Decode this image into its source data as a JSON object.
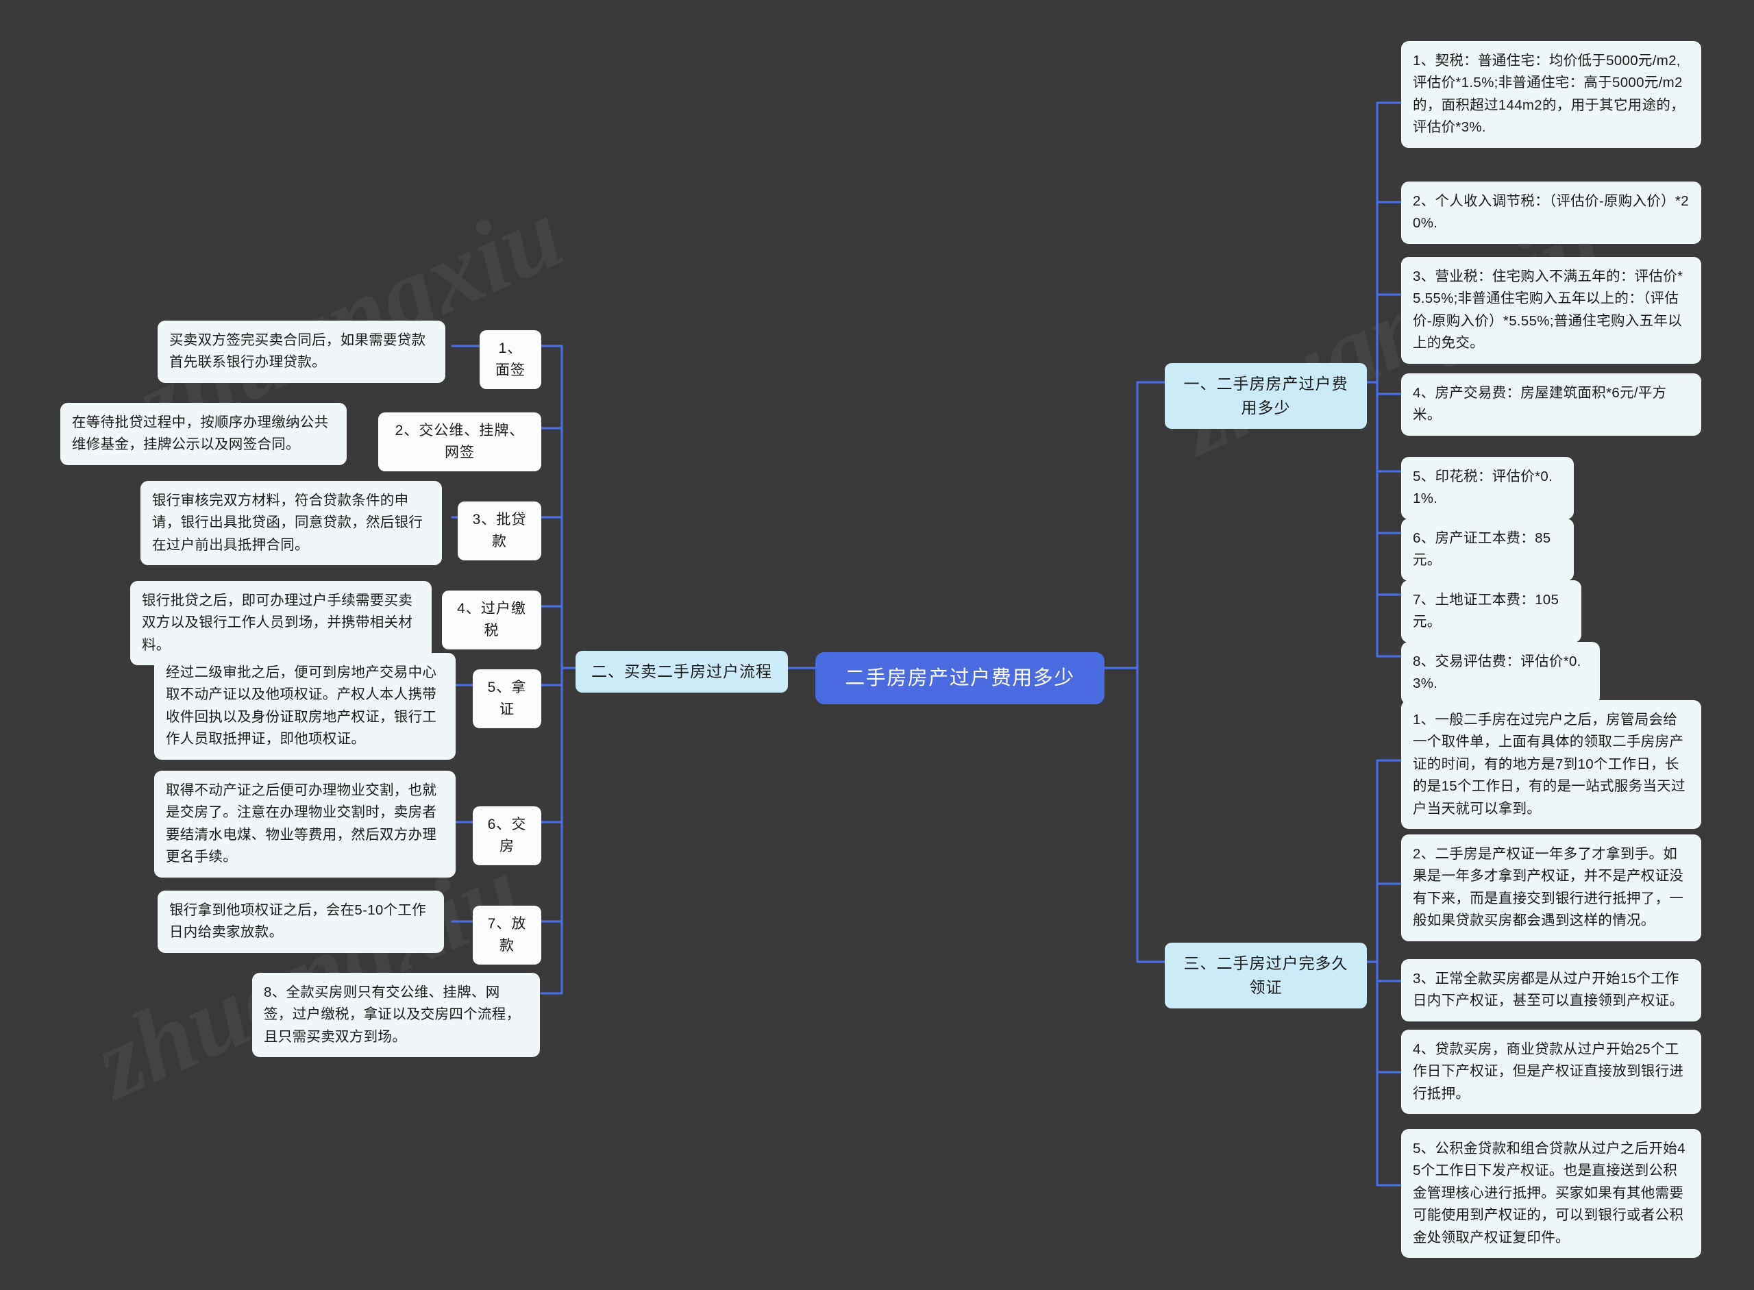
{
  "theme": {
    "background": "#3a3a3a",
    "root_fill": "#4a6ce0",
    "root_text": "#ffffff",
    "branch_fill": "#cdeaf7",
    "leaf_fill": "#eff6f8",
    "step_fill": "#fbfcfd",
    "edge_color": "#4a6ce0",
    "node_text": "#1b1b1b"
  },
  "watermarks": [
    {
      "text": "zhuangxiu"
    },
    {
      "text": "zhuangxiu"
    },
    {
      "text": "zhuangxiu"
    }
  ],
  "mindmap": {
    "root": {
      "label": "二手房房产过户费用多少"
    },
    "branches": [
      {
        "id": "branch-fees",
        "label": "一、二手房房产过户费用多少",
        "children": [
          {
            "label": "1、契税：普通住宅：均价低于5000元/m2,评估价*1.5%;非普通住宅：高于5000元/m2的，面积超过144m2的，用于其它用途的，评估价*3%."
          },
          {
            "label": "2、个人收入调节税：（评估价-原购入价）*20%."
          },
          {
            "label": "3、营业税：住宅购入不满五年的：评估价*5.55%;非普通住宅购入五年以上的：（评估价-原购入价）*5.55%;普通住宅购入五年以上的免交。"
          },
          {
            "label": "4、房产交易费：房屋建筑面积*6元/平方米。"
          },
          {
            "label": "5、印花税：评估价*0.1%."
          },
          {
            "label": "6、房产证工本费：85元。"
          },
          {
            "label": "7、土地证工本费：105元。"
          },
          {
            "label": "8、交易评估费：评估价*0.3%."
          }
        ]
      },
      {
        "id": "branch-process",
        "label": "二、买卖二手房过户流程",
        "steps": [
          {
            "label": "1、面签",
            "detail": "买卖双方签完买卖合同后，如果需要贷款首先联系银行办理贷款。"
          },
          {
            "label": "2、交公维、挂牌、网签",
            "detail": "在等待批贷过程中，按顺序办理缴纳公共维修基金，挂牌公示以及网签合同。"
          },
          {
            "label": "3、批贷款",
            "detail": "银行审核完双方材料，符合贷款条件的申请，银行出具批贷函，同意贷款，然后银行在过户前出具抵押合同。"
          },
          {
            "label": "4、过户缴税",
            "detail": "银行批贷之后，即可办理过户手续需要买卖双方以及银行工作人员到场，并携带相关材料。"
          },
          {
            "label": "5、拿证",
            "detail": "经过二级审批之后，便可到房地产交易中心取不动产证以及他项权证。产权人本人携带收件回执以及身份证取房地产权证，银行工作人员取抵押证，即他项权证。"
          },
          {
            "label": "6、交房",
            "detail": "取得不动产证之后便可办理物业交割，也就是交房了。注意在办理物业交割时，卖房者要结清水电煤、物业等费用，然后双方办理更名手续。"
          },
          {
            "label": "7、放款",
            "detail": "银行拿到他项权证之后，会在5-10个工作日内给卖家放款。"
          }
        ],
        "extra": "8、全款买房则只有交公维、挂牌、网签，过户缴税，拿证以及交房四个流程，且只需买卖双方到场。"
      },
      {
        "id": "branch-certificate",
        "label": "三、二手房过户完多久领证",
        "children": [
          {
            "label": "1、一般二手房在过完户之后，房管局会给一个取件单，上面有具体的领取二手房房产证的时间，有的地方是7到10个工作日，长的是15个工作日，有的是一站式服务当天过户当天就可以拿到。"
          },
          {
            "label": "2、二手房是产权证一年多了才拿到手。如果是一年多才拿到产权证，并不是产权证没有下来，而是直接交到银行进行抵押了，一般如果贷款买房都会遇到这样的情况。"
          },
          {
            "label": "3、正常全款买房都是从过户开始15个工作日内下产权证，甚至可以直接领到产权证。"
          },
          {
            "label": "4、贷款买房，商业贷款从过户开始25个工作日下产权证，但是产权证直接放到银行进行抵押。"
          },
          {
            "label": "5、公积金贷款和组合贷款从过户之后开始45个工作日下发产权证。也是直接送到公积金管理核心进行抵押。买家如果有其他需要可能使用到产权证的，可以到银行或者公积金处领取产权证复印件。"
          }
        ]
      }
    ]
  }
}
